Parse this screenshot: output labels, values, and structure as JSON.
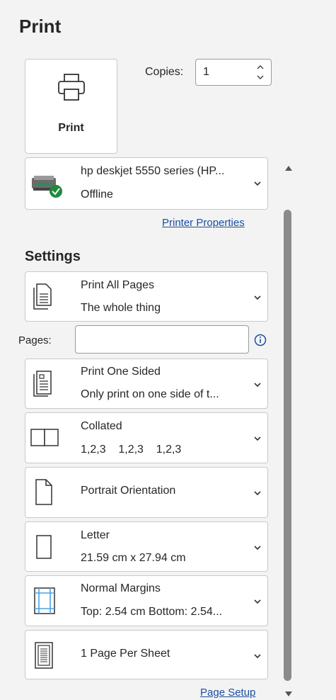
{
  "title": "Print",
  "print_button": {
    "label": "Print"
  },
  "copies": {
    "label": "Copies:",
    "value": "1"
  },
  "printer": {
    "name": "hp deskjet 5550 series (HP...",
    "status": "Offline"
  },
  "printer_properties_link": "Printer Properties",
  "settings_heading": "Settings",
  "pages_field": {
    "label": "Pages:",
    "value": ""
  },
  "settings": [
    {
      "line1": "Print All Pages",
      "line2": "The whole thing"
    },
    {
      "line1": "Print One Sided",
      "line2": "Only print on one side of t..."
    },
    {
      "line1": "Collated",
      "line2": "1,2,3    1,2,3    1,2,3"
    },
    {
      "line1": "Portrait Orientation",
      "line2": ""
    },
    {
      "line1": "Letter",
      "line2": "21.59 cm x 27.94 cm"
    },
    {
      "line1": "Normal Margins",
      "line2": "Top: 2.54 cm Bottom: 2.54..."
    },
    {
      "line1": "1 Page Per Sheet",
      "line2": ""
    }
  ],
  "page_setup_link": "Page Setup",
  "colors": {
    "accent": "#1a4fa0",
    "status_ok": "#1e8a3c",
    "margin_blue": "#4aa3e6"
  }
}
